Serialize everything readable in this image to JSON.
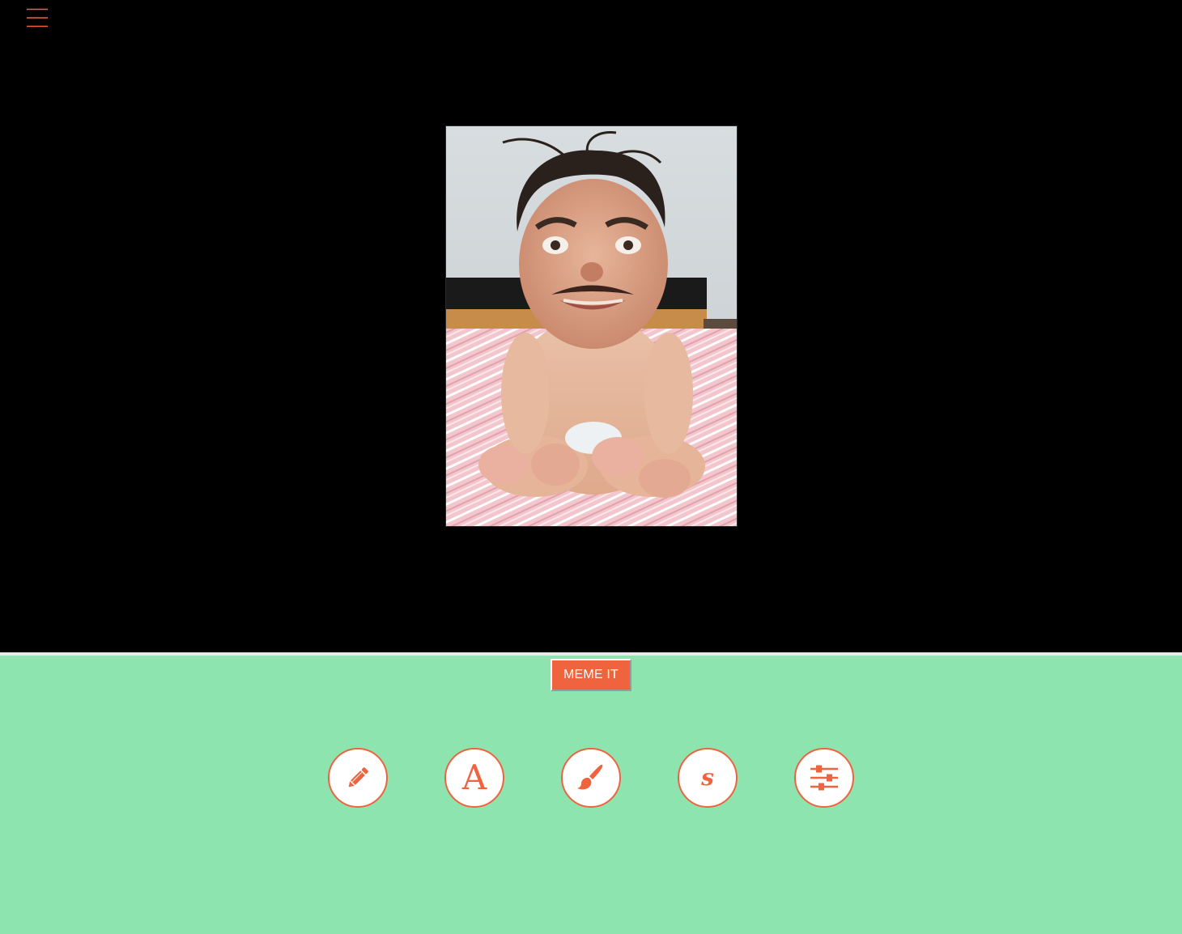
{
  "header": {
    "menu_icon": "hamburger-menu-icon"
  },
  "canvas": {
    "image_description_icon": "meme-photo"
  },
  "toolbar": {
    "meme_button_label": "MEME IT",
    "tools": [
      {
        "name": "draw",
        "icon": "pencil-icon"
      },
      {
        "name": "text",
        "icon": "font-icon",
        "glyph": "A"
      },
      {
        "name": "paint",
        "icon": "paintbrush-icon"
      },
      {
        "name": "sticker",
        "icon": "s-icon",
        "glyph": "s"
      },
      {
        "name": "adjust",
        "icon": "sliders-icon"
      }
    ]
  },
  "colors": {
    "accent": "#f0633f",
    "toolbar_bg": "#8de4af",
    "stage_bg": "#000000"
  }
}
